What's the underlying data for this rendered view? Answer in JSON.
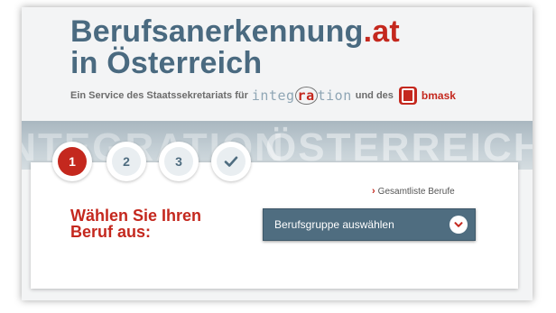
{
  "header": {
    "title_main": "Berufsanerkennung",
    "title_tld": ".at",
    "title_line2": "in Österreich",
    "service_prefix": "Ein Service des Staatssekretariats für",
    "integration_part1": "integ",
    "integration_highlight": "ra",
    "integration_part2": "tion",
    "service_mid": "und des",
    "bmask_label": "bmask"
  },
  "banner": {
    "watermark_left": "INTEGRATION",
    "watermark": "ÖSTERREICH"
  },
  "steps": [
    {
      "label": "1",
      "active": true
    },
    {
      "label": "2",
      "active": false
    },
    {
      "label": "3",
      "active": false
    },
    {
      "label": "✓",
      "active": false,
      "icon": "check-icon"
    }
  ],
  "form": {
    "all_professions_link": "Gesamtliste Berufe",
    "prompt_line1": "Wählen Sie Ihren",
    "prompt_line2": "Beruf aus:",
    "select_value": "Berufsgruppe auswählen"
  },
  "colors": {
    "brand_red": "#c4281e",
    "brand_blue": "#4a6a80",
    "select_bg": "#4f6d80"
  }
}
